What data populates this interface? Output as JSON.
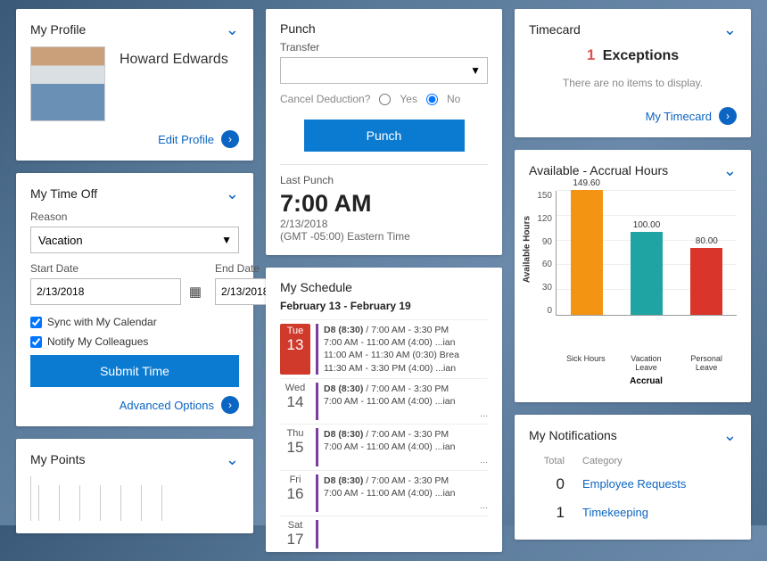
{
  "profile": {
    "card_title": "My Profile",
    "name": "Howard Edwards",
    "edit_label": "Edit Profile"
  },
  "time_off": {
    "card_title": "My Time Off",
    "reason_label": "Reason",
    "reason_value": "Vacation",
    "start_label": "Start Date",
    "start_value": "2/13/2018",
    "end_label": "End Date",
    "end_value": "2/13/2018",
    "sync_label": "Sync with My Calendar",
    "notify_label": "Notify My Colleagues",
    "submit_label": "Submit Time",
    "advanced_label": "Advanced Options"
  },
  "points": {
    "card_title": "My Points"
  },
  "punch": {
    "card_title": "Punch",
    "transfer_label": "Transfer",
    "cancel_deduction_label": "Cancel Deduction?",
    "yes_label": "Yes",
    "no_label": "No",
    "punch_button": "Punch",
    "last_punch_label": "Last Punch",
    "last_punch_time": "7:00 AM",
    "last_punch_date": "2/13/2018",
    "tz": "(GMT -05:00) Eastern Time"
  },
  "schedule": {
    "card_title": "My Schedule",
    "range": "February 13 - February 19",
    "days": [
      {
        "dow": "Tue",
        "num": "13",
        "active": true,
        "lines": [
          "D8 (8:30) / 7:00 AM - 3:30 PM",
          "7:00 AM - 11:00 AM (4:00)   ...ian",
          "11:00 AM - 11:30 AM (0:30)  Brea",
          "11:30 AM - 3:30 PM (4:00)   ...ian"
        ]
      },
      {
        "dow": "Wed",
        "num": "14",
        "lines": [
          "D8 (8:30) / 7:00 AM - 3:30 PM",
          "7:00 AM - 11:00 AM (4:00)   ...ian"
        ],
        "more": "..."
      },
      {
        "dow": "Thu",
        "num": "15",
        "lines": [
          "D8 (8:30) / 7:00 AM - 3:30 PM",
          "7:00 AM - 11:00 AM (4:00)   ...ian"
        ],
        "more": "..."
      },
      {
        "dow": "Fri",
        "num": "16",
        "lines": [
          "D8 (8:30) / 7:00 AM - 3:30 PM",
          "7:00 AM - 11:00 AM (4:00)   ...ian"
        ],
        "more": "..."
      },
      {
        "dow": "Sat",
        "num": "17",
        "lines": []
      }
    ]
  },
  "timecard": {
    "card_title": "Timecard",
    "exceptions_count": "1",
    "exceptions_label": "Exceptions",
    "empty_text": "There are no items to display.",
    "link_label": "My Timecard"
  },
  "accrual": {
    "card_title": "Available - Accrual Hours"
  },
  "chart_data": {
    "type": "bar",
    "title": "",
    "ylabel": "Available Hours",
    "xlabel": "Accrual",
    "ylim": [
      0,
      150
    ],
    "yticks": [
      0,
      30,
      60,
      90,
      120,
      150
    ],
    "categories": [
      "Sick Hours",
      "Vacation Leave",
      "Personal Leave"
    ],
    "values": [
      149.6,
      100.0,
      80.0
    ],
    "colors": [
      "#f39412",
      "#1fa3a3",
      "#d9352b"
    ]
  },
  "notifications": {
    "card_title": "My Notifications",
    "col_total": "Total",
    "col_category": "Category",
    "rows": [
      {
        "total": "0",
        "category": "Employee Requests"
      },
      {
        "total": "1",
        "category": "Timekeeping"
      }
    ]
  }
}
